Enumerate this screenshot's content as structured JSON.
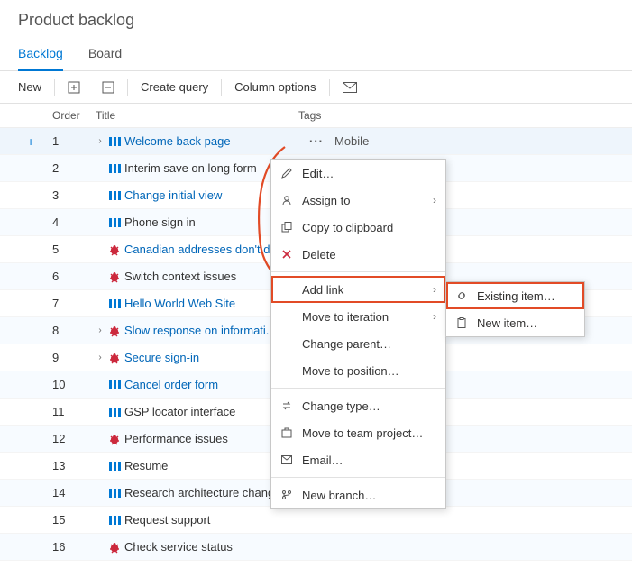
{
  "page_title": "Product backlog",
  "tabs": {
    "backlog": "Backlog",
    "board": "Board"
  },
  "toolbar": {
    "new": "New",
    "create_query": "Create query",
    "column_options": "Column options"
  },
  "columns": {
    "order": "Order",
    "title": "Title",
    "tags": "Tags"
  },
  "rows": [
    {
      "order": "1",
      "title": "Welcome back page",
      "type": "pbi",
      "link": true,
      "chev": true,
      "tag": "Mobile",
      "more": true,
      "plus": true
    },
    {
      "order": "2",
      "title": "Interim save on long form",
      "type": "pbi",
      "link": false
    },
    {
      "order": "3",
      "title": "Change initial view",
      "type": "pbi",
      "link": true
    },
    {
      "order": "4",
      "title": "Phone sign in",
      "type": "pbi",
      "link": false
    },
    {
      "order": "5",
      "title": "Canadian addresses don't di...",
      "type": "bug",
      "link": true
    },
    {
      "order": "6",
      "title": "Switch context issues",
      "type": "bug",
      "link": false
    },
    {
      "order": "7",
      "title": "Hello World Web Site",
      "type": "pbi",
      "link": true
    },
    {
      "order": "8",
      "title": "Slow response on informati...",
      "type": "bug",
      "link": true,
      "chev": true
    },
    {
      "order": "9",
      "title": "Secure sign-in",
      "type": "bug",
      "link": true,
      "chev": true
    },
    {
      "order": "10",
      "title": "Cancel order form",
      "type": "pbi",
      "link": true
    },
    {
      "order": "11",
      "title": "GSP locator interface",
      "type": "pbi",
      "link": false
    },
    {
      "order": "12",
      "title": "Performance issues",
      "type": "bug",
      "link": false
    },
    {
      "order": "13",
      "title": "Resume",
      "type": "pbi",
      "link": false
    },
    {
      "order": "14",
      "title": "Research architecture changes",
      "type": "pbi",
      "link": false
    },
    {
      "order": "15",
      "title": "Request support",
      "type": "pbi",
      "link": false
    },
    {
      "order": "16",
      "title": "Check service status",
      "type": "bug",
      "link": false
    }
  ],
  "menu": {
    "edit": "Edit…",
    "assign_to": "Assign to",
    "copy": "Copy to clipboard",
    "delete": "Delete",
    "add_link": "Add link",
    "move_iteration": "Move to iteration",
    "change_parent": "Change parent…",
    "move_position": "Move to position…",
    "change_type": "Change type…",
    "move_team": "Move to team project…",
    "email": "Email…",
    "new_branch": "New branch…"
  },
  "submenu": {
    "existing_item": "Existing item…",
    "new_item": "New item…"
  },
  "colors": {
    "accent": "#0078d4",
    "link": "#0066b8",
    "bug": "#cc293d",
    "pbi": "#0078d4",
    "highlight": "#e24b26"
  }
}
